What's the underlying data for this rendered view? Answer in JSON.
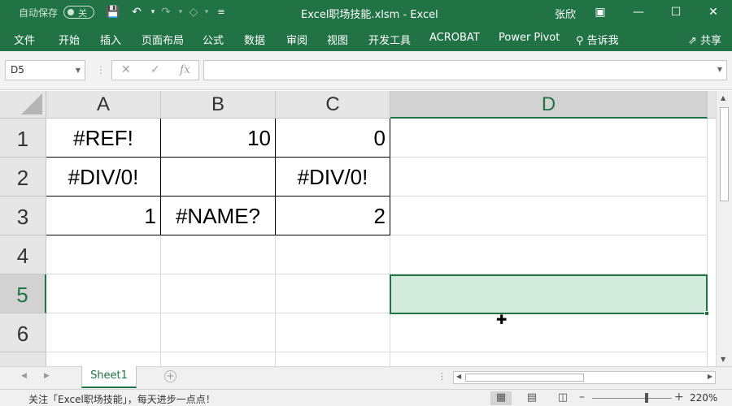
{
  "title_bar": {
    "autosave_label": "自动保存",
    "autosave_state": "关",
    "document_title": "Excel职场技能.xlsm  -  Excel",
    "user_name": "张欣"
  },
  "ribbon_tabs": [
    "文件",
    "开始",
    "插入",
    "页面布局",
    "公式",
    "数据",
    "审阅",
    "视图",
    "开发工具",
    "ACROBAT",
    "Power Pivot"
  ],
  "tell_me": "告诉我",
  "share": "共享",
  "formula_bar": {
    "name_box": "D5",
    "formula": ""
  },
  "columns": [
    "A",
    "B",
    "C",
    "D"
  ],
  "rows": [
    "1",
    "2",
    "3",
    "4",
    "5",
    "6"
  ],
  "cells": {
    "A1": "#REF!",
    "B1": "10",
    "C1": "0",
    "A2": "#DIV/0!",
    "B2": "",
    "C2": "#DIV/0!",
    "A3": "1",
    "B3": "#NAME?",
    "C3": "2"
  },
  "active_cell": "D5",
  "sheets": [
    "Sheet1"
  ],
  "status": {
    "message": "关注「Excel职场技能」，每天进步一点点！",
    "zoom": "220%"
  },
  "colors": {
    "accent": "#217346",
    "selection_fill": "#d3ebdc"
  }
}
